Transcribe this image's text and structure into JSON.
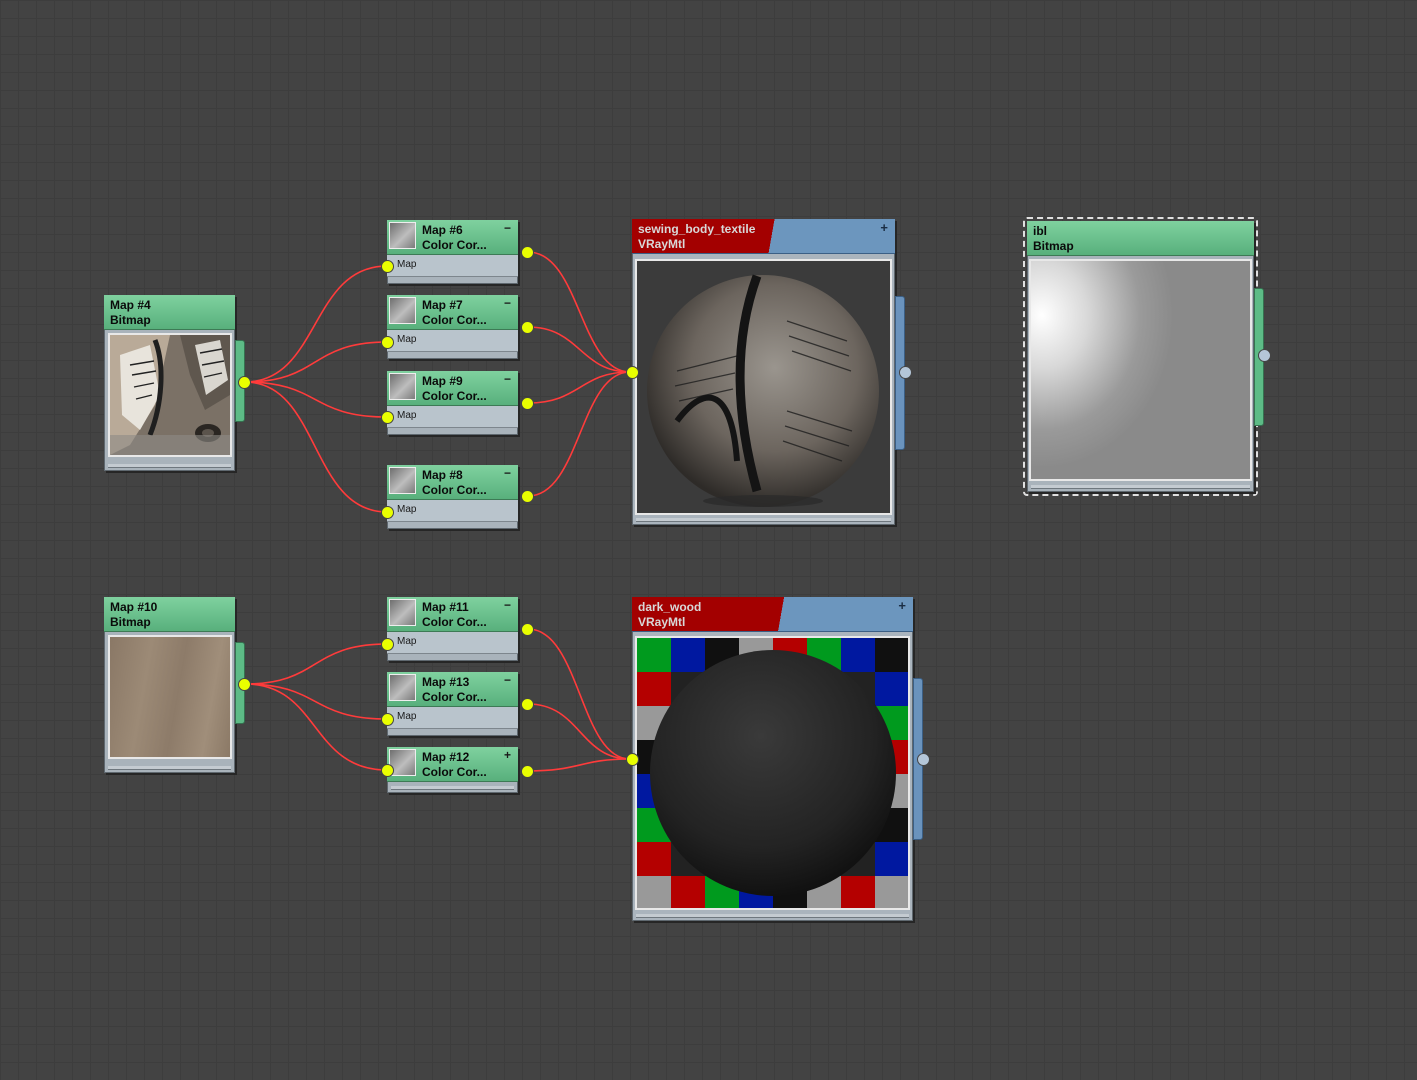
{
  "nodes": {
    "map4": {
      "title": "Map #4",
      "type": "Bitmap"
    },
    "map6": {
      "title": "Map #6",
      "type": "Color Cor...",
      "slot": "Map",
      "toggle": "−"
    },
    "map7": {
      "title": "Map #7",
      "type": "Color Cor...",
      "slot": "Map",
      "toggle": "−"
    },
    "map9": {
      "title": "Map #9",
      "type": "Color Cor...",
      "slot": "Map",
      "toggle": "−"
    },
    "map8": {
      "title": "Map #8",
      "type": "Color Cor...",
      "slot": "Map",
      "toggle": "−"
    },
    "sewing": {
      "title": "sewing_body_textile",
      "type": "VRayMtl",
      "toggle": "+"
    },
    "ibl": {
      "title": "ibl",
      "type": "Bitmap"
    },
    "map10": {
      "title": "Map #10",
      "type": "Bitmap"
    },
    "map11": {
      "title": "Map #11",
      "type": "Color Cor...",
      "slot": "Map",
      "toggle": "−"
    },
    "map13": {
      "title": "Map #13",
      "type": "Color Cor...",
      "slot": "Map",
      "toggle": "−"
    },
    "map12": {
      "title": "Map #12",
      "type": "Color Cor...",
      "toggle": "+"
    },
    "darkwood": {
      "title": "dark_wood",
      "type": "VRayMtl",
      "toggle": "+"
    }
  },
  "colors": {
    "bitmap_header": "#6cc392",
    "material_header_red": "#a30000",
    "material_header_blue": "#6c96be",
    "wire": "#ff3333",
    "socket": "#e9ff00",
    "background": "#434343"
  }
}
